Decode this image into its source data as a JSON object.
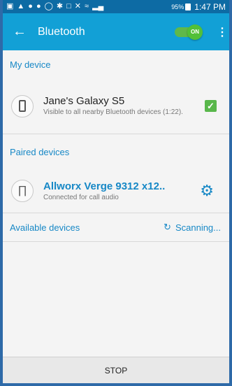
{
  "status_bar": {
    "battery": "95%",
    "time": "1:47 PM"
  },
  "app_bar": {
    "title": "Bluetooth",
    "toggle_label": "ON"
  },
  "my_device": {
    "header": "My device",
    "name": "Jane's Galaxy S5",
    "subtitle": "Visible to all nearby Bluetooth devices (1:22).",
    "visible_checked": true
  },
  "paired_devices": {
    "header": "Paired devices",
    "items": [
      {
        "name": "Allworx Verge 9312 x12..",
        "status": "Connected for call audio"
      }
    ]
  },
  "available_devices": {
    "header": "Available devices",
    "scanning_label": "Scanning..."
  },
  "bottom_bar": {
    "stop_label": "STOP"
  },
  "colors": {
    "accent": "#1788c6",
    "app_bar": "#12a0d6",
    "status_bar": "#0d6ba4",
    "toggle_on": "#52c038"
  }
}
